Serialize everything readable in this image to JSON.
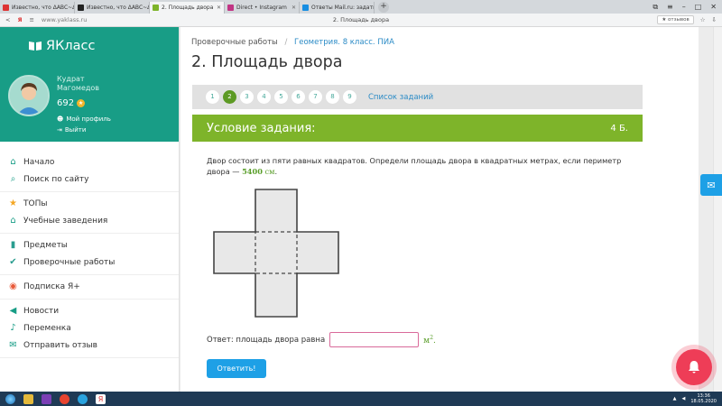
{
  "browser": {
    "tabs": [
      {
        "label": "Известно, что ΔABC~ΔA'B",
        "color": "#d33",
        "active": false
      },
      {
        "label": "Известно, что ΔABC~ΔA'B",
        "color": "#222",
        "active": false
      },
      {
        "label": "2. Площадь двора",
        "color": "#7eb42a",
        "active": true
      },
      {
        "label": "Direct • Instagram",
        "color": "#c13584",
        "active": false
      },
      {
        "label": "Ответы Mail.ru: задать",
        "color": "#168de2",
        "active": false
      }
    ],
    "new_tab": "+",
    "url": "www.yaklass.ru",
    "page_title": "2. Площадь двора",
    "reviews": "★ отзывов"
  },
  "sidebar": {
    "logo": "ЯКласс",
    "user_first": "Кудрат",
    "user_last": "Магомедов",
    "points": "692",
    "profile": "Мой профиль",
    "logout": "Выйти",
    "groups": [
      [
        {
          "label": "Начало",
          "icon": "home-icon"
        },
        {
          "label": "Поиск по сайту",
          "icon": "search-icon"
        }
      ],
      [
        {
          "label": "ТОПы",
          "icon": "star-icon"
        },
        {
          "label": "Учебные заведения",
          "icon": "school-icon"
        }
      ],
      [
        {
          "label": "Предметы",
          "icon": "books-icon"
        },
        {
          "label": "Проверочные работы",
          "icon": "check-icon"
        }
      ],
      [
        {
          "label": "Подписка Я+",
          "icon": "subscription-icon"
        }
      ],
      [
        {
          "label": "Новости",
          "icon": "megaphone-icon"
        },
        {
          "label": "Переменка",
          "icon": "bell-icon"
        },
        {
          "label": "Отправить отзыв",
          "icon": "feedback-icon"
        }
      ]
    ]
  },
  "main": {
    "breadcrumb_root": "Проверочные работы",
    "breadcrumb_sep": "/",
    "breadcrumb_current": "Геометрия. 8 класс. ПИА",
    "title": "2. Площадь двора",
    "pages": [
      "1",
      "2",
      "3",
      "4",
      "5",
      "6",
      "7",
      "8",
      "9"
    ],
    "current_page": "2",
    "task_list": "Список заданий",
    "condition_title": "Условие задания:",
    "points": "4 Б.",
    "task_text": "Двор состоит из пяти равных квадратов. Определи площадь двора в квадратных метрах, если периметр двора — ",
    "perimeter_value": "5400",
    "perimeter_unit": "см",
    "answer_label": "Ответ: площадь двора равна",
    "answer_value": "",
    "answer_unit": "м",
    "answer_unit_power": "2",
    "answer_unit_end": ".",
    "submit": "Ответить!"
  },
  "taskbar": {
    "time": "13:36",
    "date": "18.05.2020"
  }
}
